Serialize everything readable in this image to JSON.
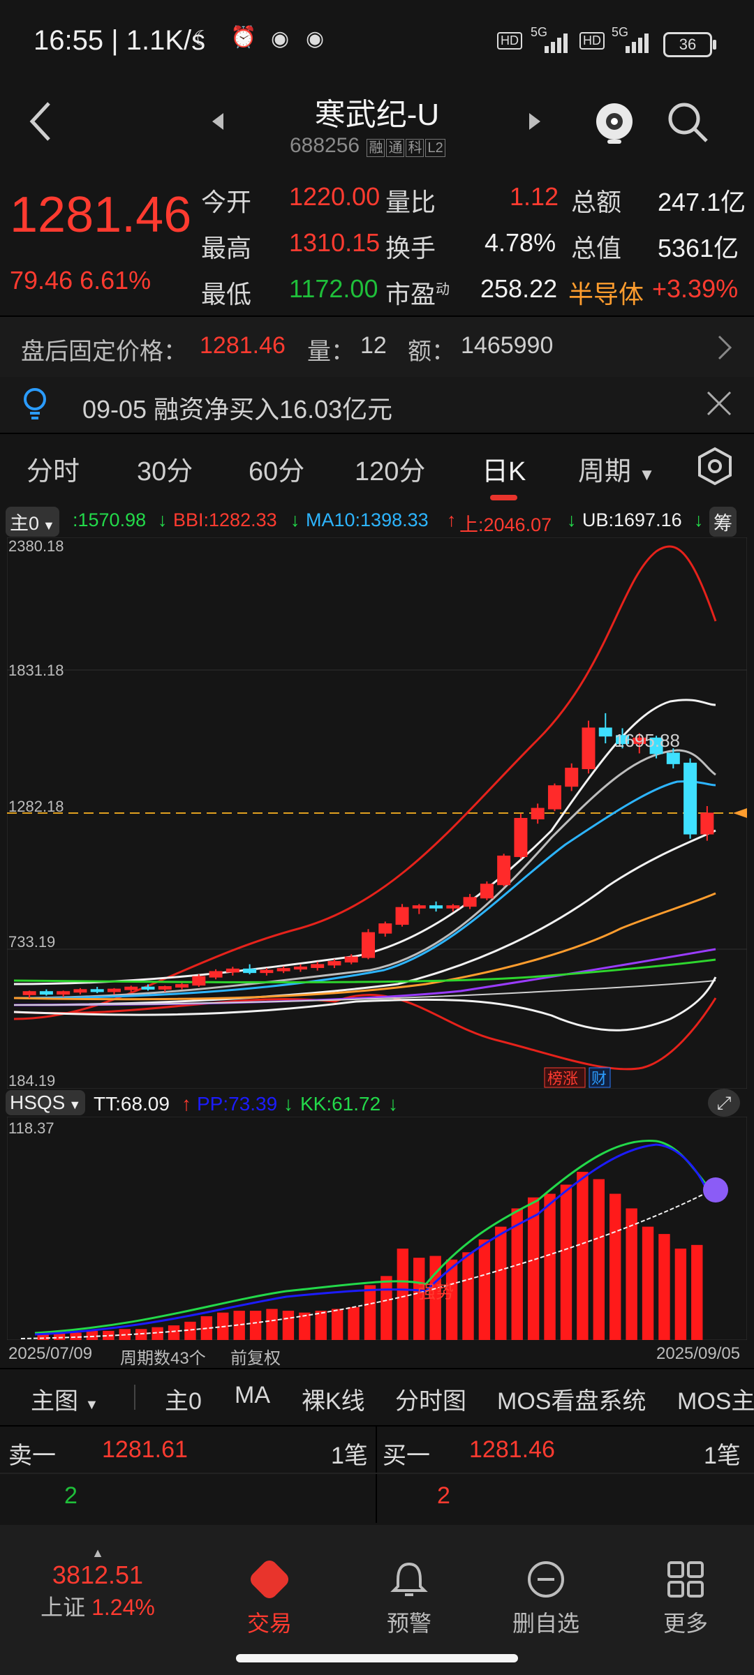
{
  "status": {
    "time": "16:55",
    "net_speed": "1.1K/s",
    "hd1": "HD",
    "net1": "5G",
    "hd2": "HD",
    "net2": "5G",
    "battery": "36"
  },
  "header": {
    "name": "寒武纪-U",
    "code": "688256",
    "tags": [
      "融",
      "通",
      "科",
      "L2"
    ]
  },
  "quote": {
    "price": "1281.46",
    "change": "79.46",
    "change_pct": "6.61%",
    "open_label": "今开",
    "open": "1220.00",
    "high_label": "最高",
    "high": "1310.15",
    "low_label": "最低",
    "low": "1172.00",
    "vol_ratio_label": "量比",
    "vol_ratio": "1.12",
    "turnover_label": "换手",
    "turnover": "4.78%",
    "pe_label": "市盈",
    "pe_sup": "动",
    "pe": "258.22",
    "amount_label": "总额",
    "amount": "247.1亿",
    "mktcap_label": "总值",
    "mktcap": "5361亿",
    "sector": "半导体",
    "sector_change": "+3.39%"
  },
  "after_hours": {
    "label": "盘后固定价格：",
    "price": "1281.46",
    "vol_label": "量：",
    "vol": "12",
    "amt_label": "额：",
    "amt": "1465990"
  },
  "notice": {
    "text": "09-05 融资净买入16.03亿元"
  },
  "period_tabs": [
    "分时",
    "30分",
    "60分",
    "120分",
    "日K",
    "周期"
  ],
  "indicators": {
    "main_selector": "主0",
    "val0": ":1570.98",
    "bbi": "BBI:1282.33",
    "ma10": "MA10:1398.33",
    "upper": "上:2046.07",
    "ub": "UB:1697.16",
    "chip_button": "筹"
  },
  "main_chart": {
    "y_labels": [
      "2380.18",
      "1831.18",
      "1282.18",
      "733.19",
      "184.19"
    ],
    "peak_label": "1695.88",
    "badge_rank": "榜涨",
    "badge_fin": "财",
    "colors": {
      "up": "#ff2a2a",
      "down": "#3fe0ff",
      "bg": "#151515"
    }
  },
  "chart_data": {
    "type": "candlestick",
    "ylim": [
      184.19,
      2380.18
    ],
    "x_start": "2025/07/09",
    "x_end": "2025/09/05",
    "series": [
      {
        "name": "BBI",
        "last": 1282.33
      },
      {
        "name": "MA10",
        "last": 1398.33
      },
      {
        "name": "上",
        "last": 2046.07
      },
      {
        "name": "UB",
        "last": 1697.16
      }
    ],
    "candles": [
      [
        560,
        575,
        545,
        570
      ],
      [
        570,
        580,
        555,
        562
      ],
      [
        562,
        575,
        550,
        570
      ],
      [
        570,
        585,
        560,
        578
      ],
      [
        578,
        590,
        565,
        572
      ],
      [
        572,
        585,
        560,
        580
      ],
      [
        580,
        595,
        570,
        588
      ],
      [
        588,
        600,
        575,
        582
      ],
      [
        582,
        595,
        570,
        590
      ],
      [
        590,
        605,
        580,
        598
      ],
      [
        598,
        640,
        590,
        630
      ],
      [
        630,
        660,
        620,
        650
      ],
      [
        650,
        670,
        635,
        660
      ],
      [
        660,
        680,
        640,
        648
      ],
      [
        648,
        665,
        635,
        655
      ],
      [
        655,
        672,
        645,
        662
      ],
      [
        662,
        680,
        650,
        668
      ],
      [
        668,
        690,
        655,
        678
      ],
      [
        678,
        700,
        665,
        690
      ],
      [
        690,
        720,
        680,
        708
      ],
      [
        708,
        820,
        700,
        805
      ],
      [
        805,
        850,
        790,
        840
      ],
      [
        840,
        920,
        830,
        905
      ],
      [
        905,
        920,
        880,
        912
      ],
      [
        912,
        930,
        890,
        905
      ],
      [
        905,
        920,
        890,
        912
      ],
      [
        912,
        960,
        900,
        945
      ],
      [
        945,
        1010,
        935,
        998
      ],
      [
        998,
        1120,
        990,
        1110
      ],
      [
        1110,
        1280,
        1100,
        1260
      ],
      [
        1260,
        1320,
        1240,
        1300
      ],
      [
        1300,
        1400,
        1290,
        1390
      ],
      [
        1390,
        1480,
        1370,
        1460
      ],
      [
        1460,
        1650,
        1440,
        1620
      ],
      [
        1620,
        1680,
        1560,
        1590
      ],
      [
        1590,
        1620,
        1540,
        1560
      ],
      [
        1560,
        1600,
        1520,
        1580
      ],
      [
        1580,
        1590,
        1500,
        1520
      ],
      [
        1520,
        1540,
        1460,
        1480
      ],
      [
        1480,
        1500,
        1180,
        1200
      ],
      [
        1200,
        1310,
        1172,
        1281
      ]
    ],
    "sub_indicator": {
      "name": "HSQS",
      "TT": 68.09,
      "PP": 73.39,
      "KK": 61.72,
      "ymax": 118.37,
      "bars": [
        3,
        4,
        4,
        5,
        5,
        6,
        6,
        7,
        8,
        10,
        13,
        15,
        16,
        16,
        17,
        16,
        15,
        16,
        17,
        18,
        30,
        35,
        50,
        45,
        46,
        44,
        48,
        55,
        62,
        72,
        78,
        80,
        85,
        92,
        88,
        80,
        72,
        62,
        58,
        50,
        52
      ]
    },
    "period_count": "周期数43个",
    "adjust": "前复权"
  },
  "sub_chart": {
    "selector": "HSQS",
    "tt": "TT:68.09",
    "pp": "PP:73.39",
    "kk": "KK:61.72",
    "y_top": "118.37",
    "trend_label": "强势"
  },
  "bottom_tabs": [
    "主图",
    "主0",
    "MA",
    "裸K线",
    "分时图",
    "MOS看盘系统",
    "MOS主"
  ],
  "orderbook": {
    "sell1_label": "卖一",
    "sell1_price": "1281.61",
    "sell1_cnt": "1笔",
    "sell1_vol": "2",
    "buy1_label": "买一",
    "buy1_price": "1281.46",
    "buy1_cnt": "1笔",
    "buy1_vol": "2"
  },
  "tabbar": {
    "index_value": "3812.51",
    "index_name": "上证",
    "index_change": "1.24%",
    "items": [
      "交易",
      "预警",
      "删自选",
      "更多"
    ]
  }
}
